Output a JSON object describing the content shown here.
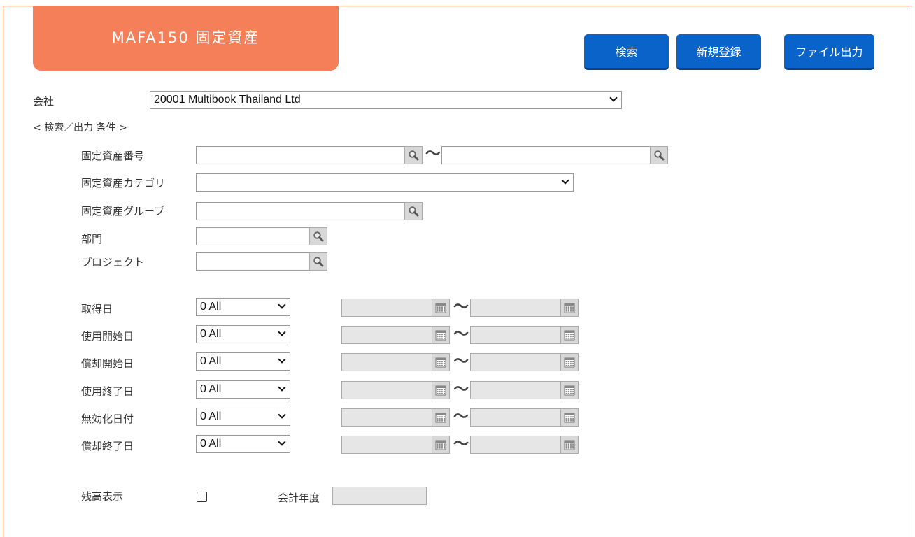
{
  "header": {
    "title": "MAFA150 固定資産",
    "buttons": {
      "search": "検索",
      "new": "新規登録",
      "export": "ファイル出力"
    }
  },
  "company": {
    "label": "会社",
    "value": "20001 Multibook Thailand Ltd"
  },
  "conditions_heading": "< 検索／出力 条件 >",
  "fields": {
    "asset_number": "固定資産番号",
    "asset_category": "固定資産カテゴリ",
    "asset_group": "固定資産グループ",
    "department": "部門",
    "project": "プロジェクト"
  },
  "range_sep": "〜",
  "date_filters": [
    {
      "label": "取得日",
      "value": "0 All"
    },
    {
      "label": "使用開始日",
      "value": "0 All"
    },
    {
      "label": "償却開始日",
      "value": "0 All"
    },
    {
      "label": "使用終了日",
      "value": "0 All"
    },
    {
      "label": "無効化日付",
      "value": "0 All"
    },
    {
      "label": "償却終了日",
      "value": "0 All"
    }
  ],
  "balance": {
    "label": "残高表示",
    "fiscal_year_label": "会計年度"
  },
  "colors": {
    "accent": "#f47f58",
    "button": "#0a63c9"
  },
  "icons": {
    "lookup": "search-icon",
    "date": "calendar-icon",
    "dropdown": "chevron-down-icon"
  }
}
